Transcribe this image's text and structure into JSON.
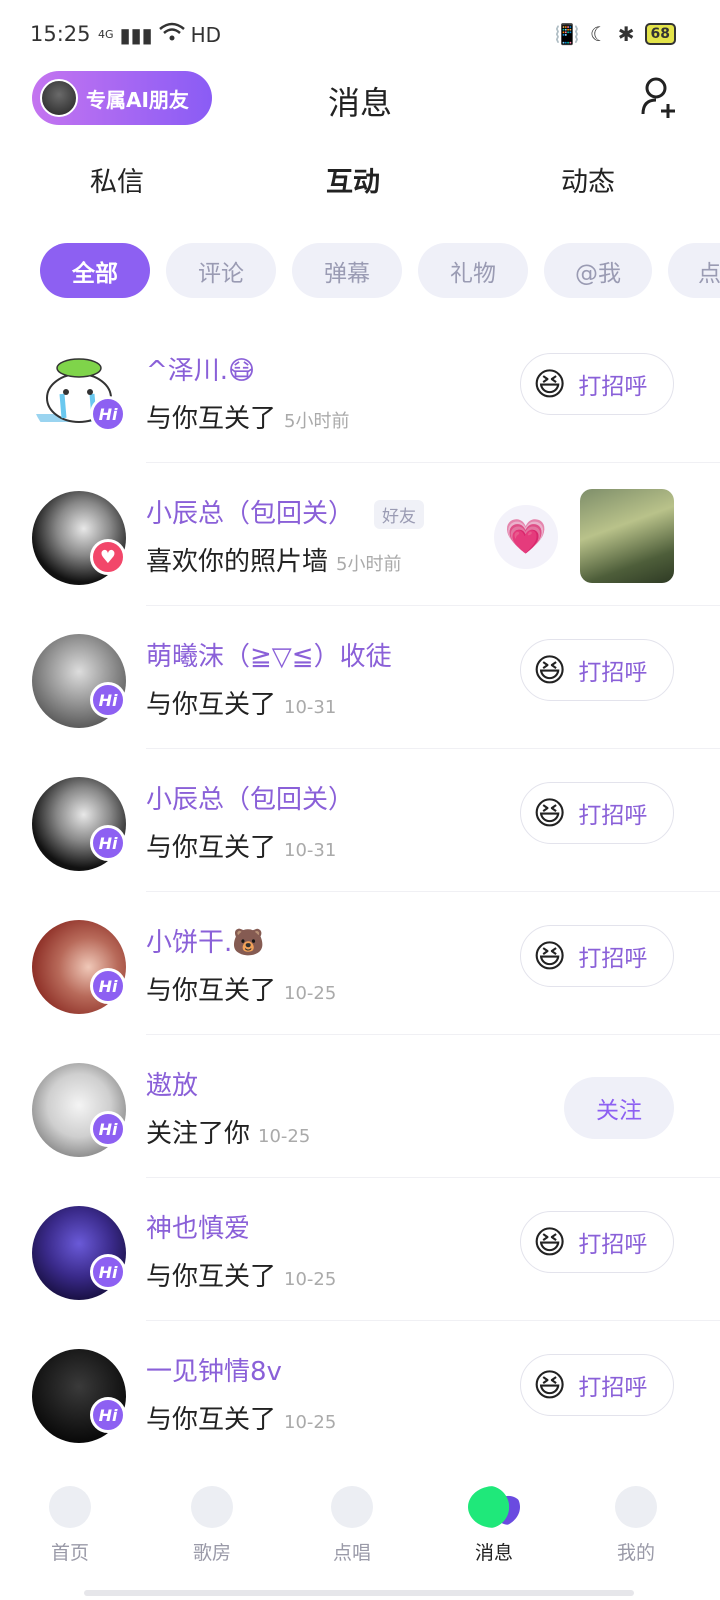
{
  "status_bar": {
    "time": "15:25",
    "network": "4G",
    "hd": "HD",
    "battery": "68"
  },
  "header": {
    "ai_label": "专属AI朋友",
    "title": "消息",
    "add_friend_icon": "add-user-icon"
  },
  "tabs": [
    {
      "label": "私信",
      "active": false
    },
    {
      "label": "互动",
      "active": true
    },
    {
      "label": "动态",
      "active": false
    }
  ],
  "chips": [
    {
      "label": "全部",
      "active": true
    },
    {
      "label": "评论"
    },
    {
      "label": "弹幕"
    },
    {
      "label": "礼物"
    },
    {
      "label": "@我"
    },
    {
      "label": "点"
    }
  ],
  "list": [
    {
      "name": "^泽川.😷",
      "action": "与你互关了",
      "time": "5小时前",
      "button": "打招呼",
      "badge": "Hi"
    },
    {
      "name": "小辰总（包回关）",
      "tag": "好友",
      "action": "喜欢你的照片墙",
      "time": "5小时前",
      "badge": "heart"
    },
    {
      "name": "萌曦沫（≧▽≦）收徒",
      "action": "与你互关了",
      "time": "10-31",
      "button": "打招呼",
      "badge": "Hi"
    },
    {
      "name": "小辰总（包回关）",
      "action": "与你互关了",
      "time": "10-31",
      "button": "打招呼",
      "badge": "Hi"
    },
    {
      "name": "小饼干.🐻",
      "action": "与你互关了",
      "time": "10-25",
      "button": "打招呼",
      "badge": "Hi"
    },
    {
      "name": "遨放",
      "action": "关注了你",
      "time": "10-25",
      "button": "关注",
      "badge": "Hi"
    },
    {
      "name": "神也慎爱",
      "action": "与你互关了",
      "time": "10-25",
      "button": "打招呼",
      "badge": "Hi"
    },
    {
      "name": "一见钟情8v",
      "action": "与你互关了",
      "time": "10-25",
      "button": "打招呼",
      "badge": "Hi"
    }
  ],
  "bottom_nav": [
    {
      "label": "首页",
      "icon": "home-icon"
    },
    {
      "label": "歌房",
      "icon": "music-note-icon"
    },
    {
      "label": "点唱",
      "icon": "chat-bubble-icon"
    },
    {
      "label": "消息",
      "icon": "message-icon",
      "active": true
    },
    {
      "label": "我的",
      "icon": "profile-icon"
    }
  ],
  "colors": {
    "accent": "#8d60f2",
    "name": "#8a60d8",
    "tab_underline": "#3fe6a0",
    "heart": "#f2476a"
  }
}
